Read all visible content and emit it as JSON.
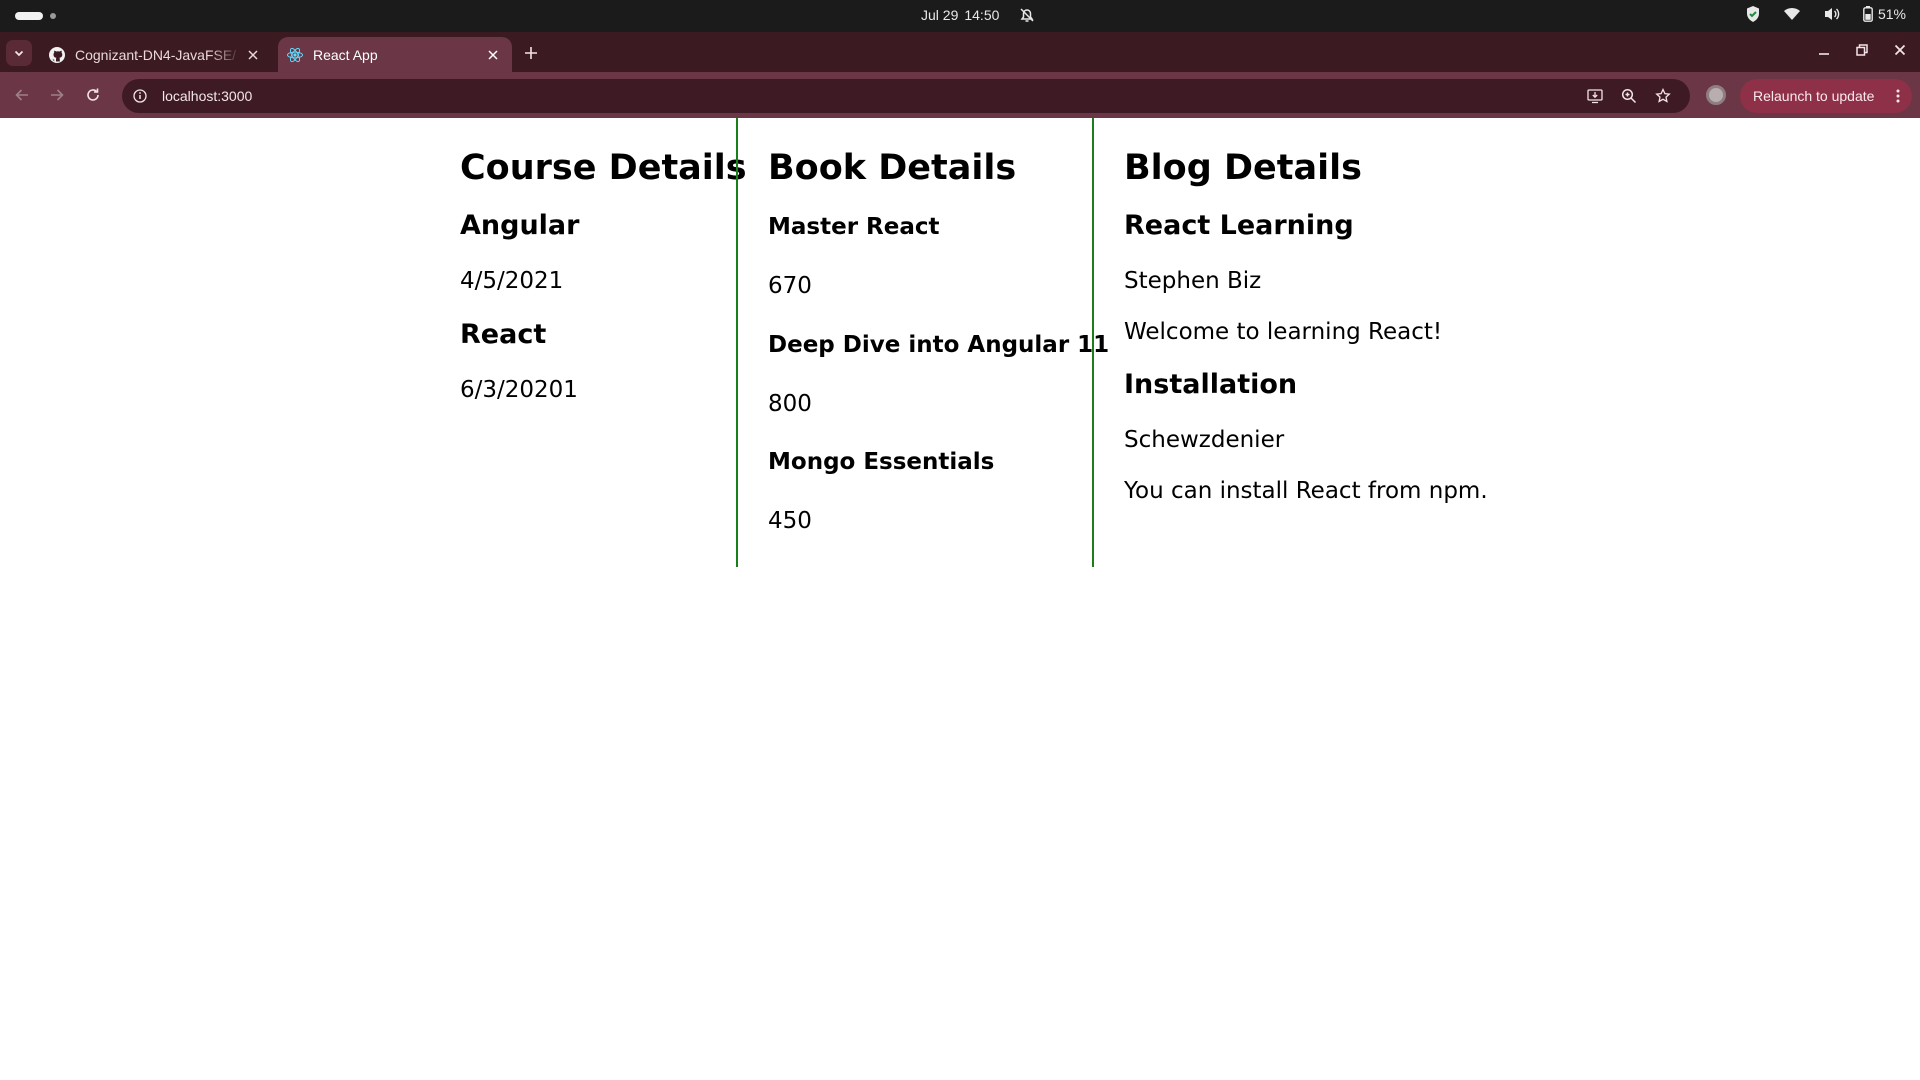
{
  "os": {
    "date": "Jul 29",
    "time": "14:50",
    "battery": "51%"
  },
  "browser": {
    "tabs": [
      {
        "title": "Cognizant-DN4-JavaFSE/",
        "icon": "github-icon",
        "active": false
      },
      {
        "title": "React App",
        "icon": "react-icon",
        "active": true
      }
    ],
    "url": "localhost:3000",
    "relaunch_label": "Relaunch to update",
    "colors": {
      "tabstrip": "#3b1a22",
      "toolbar": "#6b3645",
      "omnibox": "#3e1a24",
      "relaunch": "#8e3048"
    }
  },
  "page": {
    "divider_color": "#1a7f1a",
    "course": {
      "title": "Course Details",
      "items": [
        {
          "name": "Angular",
          "date": "4/5/2021"
        },
        {
          "name": "React",
          "date": "6/3/20201"
        }
      ]
    },
    "book": {
      "title": "Book Details",
      "items": [
        {
          "name": "Master React",
          "price": "670"
        },
        {
          "name": "Deep Dive into Angular 11",
          "price": "800"
        },
        {
          "name": "Mongo Essentials",
          "price": "450"
        }
      ]
    },
    "blog": {
      "title": "Blog Details",
      "items": [
        {
          "title": "React Learning",
          "author": "Stephen Biz",
          "body": "Welcome to learning React!"
        },
        {
          "title": "Installation",
          "author": "Schewzdenier",
          "body": "You can install React from npm."
        }
      ]
    }
  }
}
